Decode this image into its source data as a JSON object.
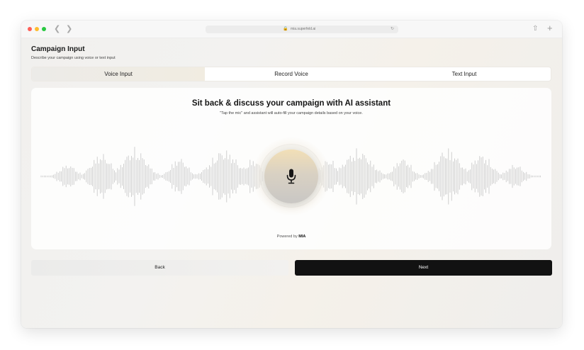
{
  "browser": {
    "url": "mia.superfeld.ai",
    "lock_icon": "lock-icon",
    "reload_icon": "reload-icon",
    "share_icon": "share-icon",
    "new_tab_icon": "plus-icon"
  },
  "header": {
    "title": "Campaign Input",
    "subtitle": "Describe your campaign using voice or text input"
  },
  "tabs": [
    {
      "label": "Voice Input",
      "active": true
    },
    {
      "label": "Record Voice",
      "active": false
    },
    {
      "label": "Text Input",
      "active": false
    }
  ],
  "panel": {
    "headline": "Sit back & discuss your campaign with AI assistant",
    "subheadline": "\"Tap the mic\" and assistant will auto-fill your campaign details based on your voice.",
    "mic_icon": "microphone-icon",
    "powered_prefix": "Powered by",
    "powered_brand": "MIA"
  },
  "actions": {
    "back_label": "Back",
    "next_label": "Next"
  },
  "colors": {
    "accent": "#121212",
    "mic_gradient_top": "#f2dfb6",
    "mic_gradient_bottom": "#c9c7c4",
    "waveform": "#c4c4c4"
  }
}
